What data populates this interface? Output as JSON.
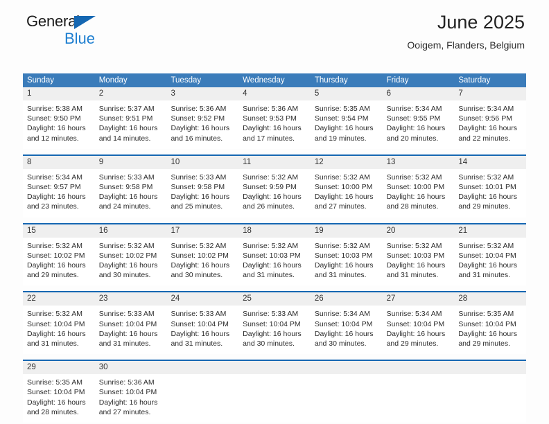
{
  "brand": {
    "line1": "General",
    "line2": "Blue",
    "accent_color": "#1567b2"
  },
  "header": {
    "title": "June 2025",
    "location": "Ooigem, Flanders, Belgium"
  },
  "calendar": {
    "header_bg": "#3b7cba",
    "row_divider_color": "#1567b2",
    "day_band_bg": "#efefef",
    "weekdays": [
      "Sunday",
      "Monday",
      "Tuesday",
      "Wednesday",
      "Thursday",
      "Friday",
      "Saturday"
    ],
    "weeks": [
      [
        {
          "day": "1",
          "sunrise": "Sunrise: 5:38 AM",
          "sunset": "Sunset: 9:50 PM",
          "daylight1": "Daylight: 16 hours",
          "daylight2": "and 12 minutes."
        },
        {
          "day": "2",
          "sunrise": "Sunrise: 5:37 AM",
          "sunset": "Sunset: 9:51 PM",
          "daylight1": "Daylight: 16 hours",
          "daylight2": "and 14 minutes."
        },
        {
          "day": "3",
          "sunrise": "Sunrise: 5:36 AM",
          "sunset": "Sunset: 9:52 PM",
          "daylight1": "Daylight: 16 hours",
          "daylight2": "and 16 minutes."
        },
        {
          "day": "4",
          "sunrise": "Sunrise: 5:36 AM",
          "sunset": "Sunset: 9:53 PM",
          "daylight1": "Daylight: 16 hours",
          "daylight2": "and 17 minutes."
        },
        {
          "day": "5",
          "sunrise": "Sunrise: 5:35 AM",
          "sunset": "Sunset: 9:54 PM",
          "daylight1": "Daylight: 16 hours",
          "daylight2": "and 19 minutes."
        },
        {
          "day": "6",
          "sunrise": "Sunrise: 5:34 AM",
          "sunset": "Sunset: 9:55 PM",
          "daylight1": "Daylight: 16 hours",
          "daylight2": "and 20 minutes."
        },
        {
          "day": "7",
          "sunrise": "Sunrise: 5:34 AM",
          "sunset": "Sunset: 9:56 PM",
          "daylight1": "Daylight: 16 hours",
          "daylight2": "and 22 minutes."
        }
      ],
      [
        {
          "day": "8",
          "sunrise": "Sunrise: 5:34 AM",
          "sunset": "Sunset: 9:57 PM",
          "daylight1": "Daylight: 16 hours",
          "daylight2": "and 23 minutes."
        },
        {
          "day": "9",
          "sunrise": "Sunrise: 5:33 AM",
          "sunset": "Sunset: 9:58 PM",
          "daylight1": "Daylight: 16 hours",
          "daylight2": "and 24 minutes."
        },
        {
          "day": "10",
          "sunrise": "Sunrise: 5:33 AM",
          "sunset": "Sunset: 9:58 PM",
          "daylight1": "Daylight: 16 hours",
          "daylight2": "and 25 minutes."
        },
        {
          "day": "11",
          "sunrise": "Sunrise: 5:32 AM",
          "sunset": "Sunset: 9:59 PM",
          "daylight1": "Daylight: 16 hours",
          "daylight2": "and 26 minutes."
        },
        {
          "day": "12",
          "sunrise": "Sunrise: 5:32 AM",
          "sunset": "Sunset: 10:00 PM",
          "daylight1": "Daylight: 16 hours",
          "daylight2": "and 27 minutes."
        },
        {
          "day": "13",
          "sunrise": "Sunrise: 5:32 AM",
          "sunset": "Sunset: 10:00 PM",
          "daylight1": "Daylight: 16 hours",
          "daylight2": "and 28 minutes."
        },
        {
          "day": "14",
          "sunrise": "Sunrise: 5:32 AM",
          "sunset": "Sunset: 10:01 PM",
          "daylight1": "Daylight: 16 hours",
          "daylight2": "and 29 minutes."
        }
      ],
      [
        {
          "day": "15",
          "sunrise": "Sunrise: 5:32 AM",
          "sunset": "Sunset: 10:02 PM",
          "daylight1": "Daylight: 16 hours",
          "daylight2": "and 29 minutes."
        },
        {
          "day": "16",
          "sunrise": "Sunrise: 5:32 AM",
          "sunset": "Sunset: 10:02 PM",
          "daylight1": "Daylight: 16 hours",
          "daylight2": "and 30 minutes."
        },
        {
          "day": "17",
          "sunrise": "Sunrise: 5:32 AM",
          "sunset": "Sunset: 10:02 PM",
          "daylight1": "Daylight: 16 hours",
          "daylight2": "and 30 minutes."
        },
        {
          "day": "18",
          "sunrise": "Sunrise: 5:32 AM",
          "sunset": "Sunset: 10:03 PM",
          "daylight1": "Daylight: 16 hours",
          "daylight2": "and 31 minutes."
        },
        {
          "day": "19",
          "sunrise": "Sunrise: 5:32 AM",
          "sunset": "Sunset: 10:03 PM",
          "daylight1": "Daylight: 16 hours",
          "daylight2": "and 31 minutes."
        },
        {
          "day": "20",
          "sunrise": "Sunrise: 5:32 AM",
          "sunset": "Sunset: 10:03 PM",
          "daylight1": "Daylight: 16 hours",
          "daylight2": "and 31 minutes."
        },
        {
          "day": "21",
          "sunrise": "Sunrise: 5:32 AM",
          "sunset": "Sunset: 10:04 PM",
          "daylight1": "Daylight: 16 hours",
          "daylight2": "and 31 minutes."
        }
      ],
      [
        {
          "day": "22",
          "sunrise": "Sunrise: 5:32 AM",
          "sunset": "Sunset: 10:04 PM",
          "daylight1": "Daylight: 16 hours",
          "daylight2": "and 31 minutes."
        },
        {
          "day": "23",
          "sunrise": "Sunrise: 5:33 AM",
          "sunset": "Sunset: 10:04 PM",
          "daylight1": "Daylight: 16 hours",
          "daylight2": "and 31 minutes."
        },
        {
          "day": "24",
          "sunrise": "Sunrise: 5:33 AM",
          "sunset": "Sunset: 10:04 PM",
          "daylight1": "Daylight: 16 hours",
          "daylight2": "and 31 minutes."
        },
        {
          "day": "25",
          "sunrise": "Sunrise: 5:33 AM",
          "sunset": "Sunset: 10:04 PM",
          "daylight1": "Daylight: 16 hours",
          "daylight2": "and 30 minutes."
        },
        {
          "day": "26",
          "sunrise": "Sunrise: 5:34 AM",
          "sunset": "Sunset: 10:04 PM",
          "daylight1": "Daylight: 16 hours",
          "daylight2": "and 30 minutes."
        },
        {
          "day": "27",
          "sunrise": "Sunrise: 5:34 AM",
          "sunset": "Sunset: 10:04 PM",
          "daylight1": "Daylight: 16 hours",
          "daylight2": "and 29 minutes."
        },
        {
          "day": "28",
          "sunrise": "Sunrise: 5:35 AM",
          "sunset": "Sunset: 10:04 PM",
          "daylight1": "Daylight: 16 hours",
          "daylight2": "and 29 minutes."
        }
      ],
      [
        {
          "day": "29",
          "sunrise": "Sunrise: 5:35 AM",
          "sunset": "Sunset: 10:04 PM",
          "daylight1": "Daylight: 16 hours",
          "daylight2": "and 28 minutes."
        },
        {
          "day": "30",
          "sunrise": "Sunrise: 5:36 AM",
          "sunset": "Sunset: 10:04 PM",
          "daylight1": "Daylight: 16 hours",
          "daylight2": "and 27 minutes."
        },
        {
          "day": "",
          "sunrise": "",
          "sunset": "",
          "daylight1": "",
          "daylight2": ""
        },
        {
          "day": "",
          "sunrise": "",
          "sunset": "",
          "daylight1": "",
          "daylight2": ""
        },
        {
          "day": "",
          "sunrise": "",
          "sunset": "",
          "daylight1": "",
          "daylight2": ""
        },
        {
          "day": "",
          "sunrise": "",
          "sunset": "",
          "daylight1": "",
          "daylight2": ""
        },
        {
          "day": "",
          "sunrise": "",
          "sunset": "",
          "daylight1": "",
          "daylight2": ""
        }
      ]
    ]
  }
}
